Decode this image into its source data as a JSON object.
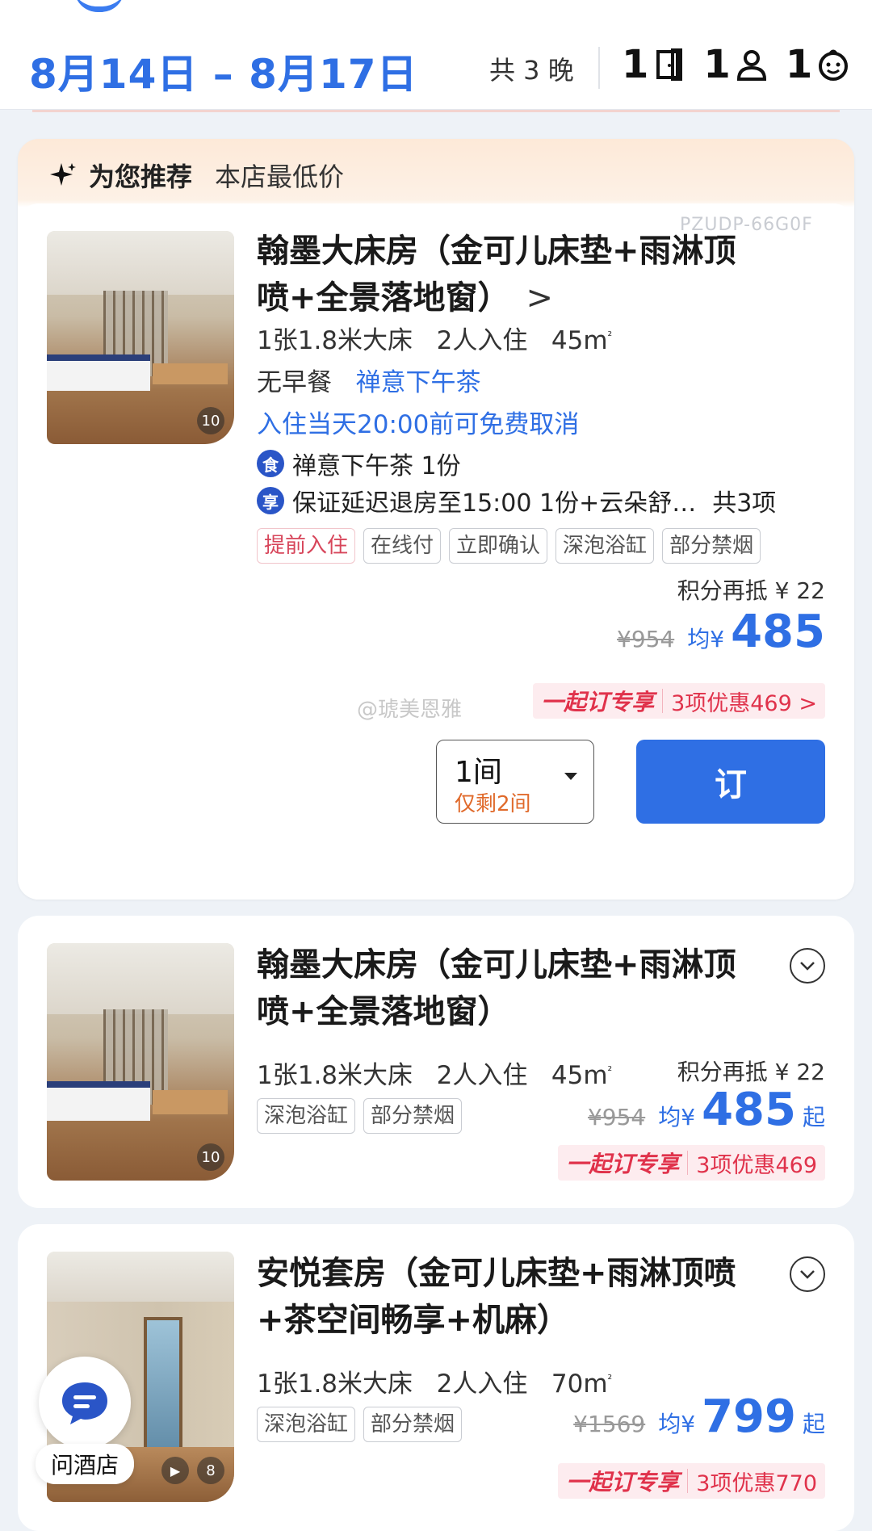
{
  "header": {
    "dates": "8月14日 – 8月17日",
    "nights": "共 3 晚",
    "rooms": "1",
    "adults": "1",
    "children": "1"
  },
  "recommend": {
    "title": "为您推荐",
    "subtitle": "本店最低价"
  },
  "colors": {
    "accent": "#2f6fe4",
    "promo_red": "#e0324b",
    "orange": "#e06a2b"
  },
  "rooms": [
    {
      "code": "PZUDP-66G0F",
      "name": "翰墨大床房（金可儿床垫+雨淋顶喷+全景落地窗）",
      "chevron": ">",
      "bed": "1张1.8米大床",
      "guests": "2人入住",
      "area": "45m",
      "area_sup": "²",
      "meal": "无早餐",
      "meal_extra": "禅意下午茶",
      "cancel": "入住当天20:00前可免费取消",
      "perk1_icon": "食",
      "perk1": "禅意下午茶 1份",
      "perk2_icon": "享",
      "perk2": "保证延迟退房至15:00 1份+云朵舒…",
      "perk2_total": "共3项",
      "tags": [
        "提前入住",
        "在线付",
        "立即确认",
        "深泡浴缸",
        "部分禁烟"
      ],
      "points": "积分再抵 ¥ 22",
      "old_price": "¥954",
      "avg_label": "均¥",
      "price": "485",
      "promo_label": "一起订专享",
      "promo_detail": "3项优惠469 >",
      "watermark": "@琥美恩雅",
      "thumb_count": "10",
      "qty": "1间",
      "qty_sub": "仅剩2间",
      "book": "订"
    },
    {
      "name": "翰墨大床房（金可儿床垫+雨淋顶喷+全景落地窗）",
      "bed": "1张1.8米大床",
      "guests": "2人入住",
      "area": "45m",
      "area_sup": "²",
      "tags": [
        "深泡浴缸",
        "部分禁烟"
      ],
      "points": "积分再抵 ¥ 22",
      "old_price": "¥954",
      "avg_label": "均¥",
      "price": "485",
      "qi": "起",
      "promo_label": "一起订专享",
      "promo_detail": "3项优惠469",
      "thumb_count": "10"
    },
    {
      "name": "安悦套房（金可儿床垫+雨淋顶喷+茶空间畅享+机麻）",
      "bed": "1张1.8米大床",
      "guests": "2人入住",
      "area": "70m",
      "area_sup": "²",
      "tags": [
        "深泡浴缸",
        "部分禁烟"
      ],
      "old_price": "¥1569",
      "avg_label": "均¥",
      "price": "799",
      "qi": "起",
      "promo_label": "一起订专享",
      "promo_detail": "3项优惠770",
      "thumb_count": "8"
    }
  ],
  "chat": {
    "label": "问酒店",
    "icon": "chat-bubble-icon"
  }
}
